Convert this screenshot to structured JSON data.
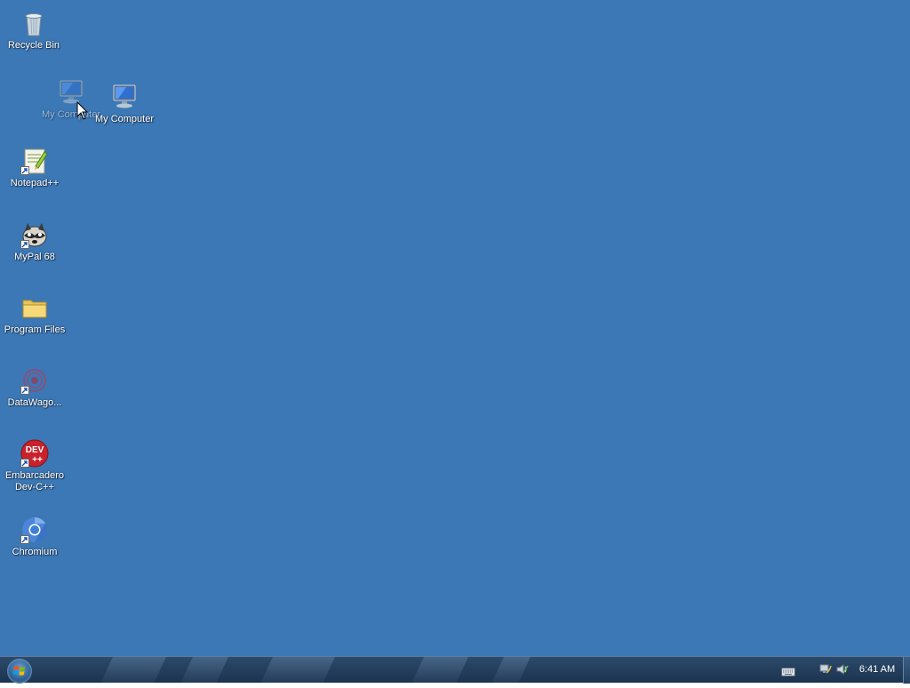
{
  "desktop": {
    "background_color": "#3b78b5",
    "icons": [
      {
        "label": "Recycle Bin",
        "icon": "recycle-bin-icon"
      },
      {
        "label": "My Computer",
        "icon": "computer-icon",
        "state": "dragging-ghost"
      },
      {
        "label": "My Computer",
        "icon": "computer-icon"
      },
      {
        "label": "Notepad++",
        "icon": "notepad-plus-plus-icon",
        "shortcut": true
      },
      {
        "label": "MyPal 68",
        "icon": "mypal-raccoon-icon",
        "shortcut": true
      },
      {
        "label": "Program Files",
        "icon": "folder-icon"
      },
      {
        "label": "DataWago...",
        "icon": "datawagon-icon",
        "shortcut": true
      },
      {
        "label": "Embarcadero Dev-C++",
        "icon": "dev-cpp-icon",
        "shortcut": true
      },
      {
        "label": "Chromium",
        "icon": "chromium-icon",
        "shortcut": true
      }
    ]
  },
  "taskbar": {
    "start_icon": "windows-orb-icon",
    "tray_icons": [
      "keyboard-icon",
      "network-icon",
      "volume-icon"
    ],
    "clock": "6:41 AM"
  }
}
